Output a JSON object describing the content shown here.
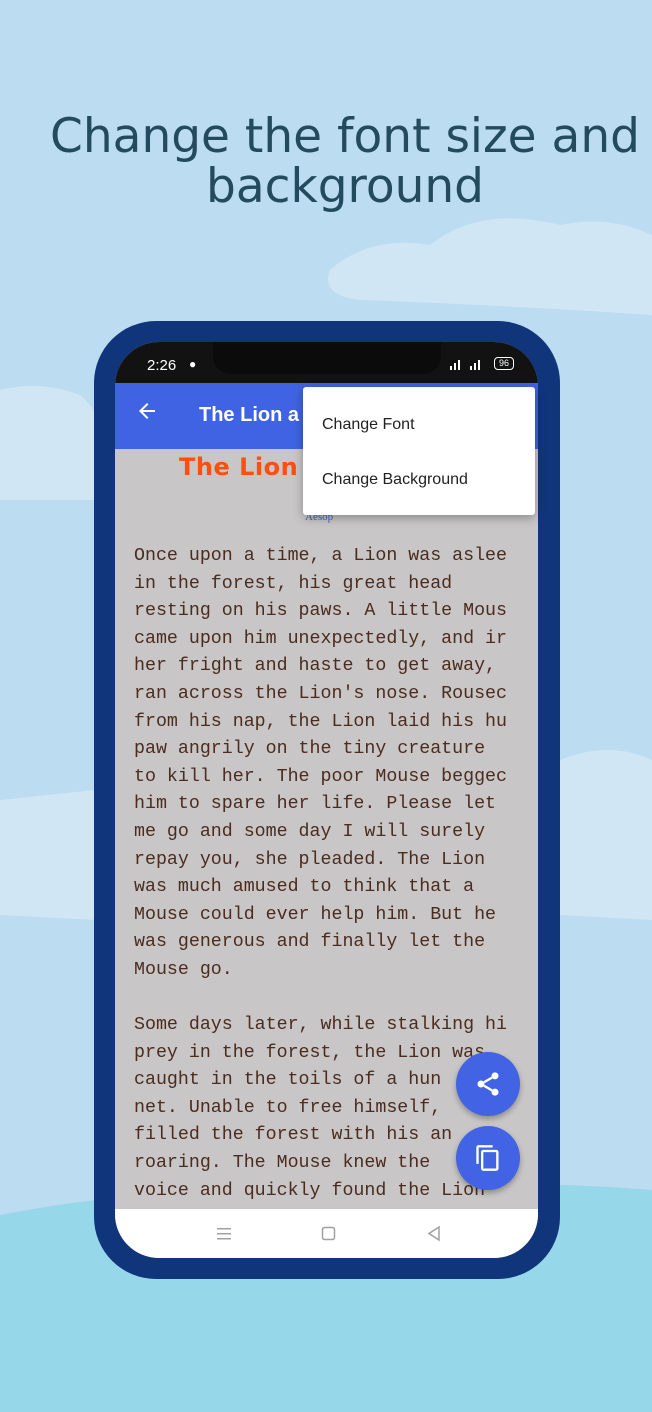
{
  "headline": {
    "line1": "Change the font size and",
    "line2": "background"
  },
  "status_bar": {
    "time": "2:26",
    "battery": "96"
  },
  "app_bar": {
    "title": "The Lion a",
    "back_icon": "arrow-left-icon"
  },
  "menu": {
    "items": [
      {
        "label": "Change Font"
      },
      {
        "label": "Change Background"
      }
    ]
  },
  "story": {
    "title": "The Lion a",
    "author": "Aesop",
    "lines": [
      "Once upon a time, a Lion was aslee",
      "in the forest, his great head",
      "resting on his paws. A little Mous",
      "came upon him unexpectedly, and ir",
      "her fright and haste to get away,",
      "ran across the Lion's nose. Rousec",
      "from his nap, the Lion laid his hu",
      "paw angrily on the tiny creature",
      "to kill her. The poor Mouse beggec",
      "him to spare her life. Please let",
      "me go and some day I will surely",
      "repay you, she pleaded. The Lion",
      "was much amused to think that a",
      "Mouse could ever help him. But he",
      "was generous and finally let the",
      "Mouse go.",
      "",
      "Some days later, while stalking hi",
      "prey in the forest, the Lion was",
      "caught in the toils of a hun",
      "net. Unable to free himself,",
      "filled the forest with his an",
      "roaring. The Mouse knew the",
      "voice and quickly found the Lion"
    ]
  },
  "fabs": {
    "share_icon": "share-icon",
    "copy_icon": "copy-icon"
  },
  "nav_bar": {
    "menu_icon": "menu-icon",
    "home_icon": "square-icon",
    "back_icon": "triangle-back-icon"
  },
  "colors": {
    "background": "#bcdcf1",
    "phone_frame": "#10357a",
    "app_bar": "#3f63e3",
    "story_title": "#ff4e0f",
    "story_text": "#4b2c1e",
    "content_bg": "#c8c6c6",
    "fab": "#4264e4"
  }
}
